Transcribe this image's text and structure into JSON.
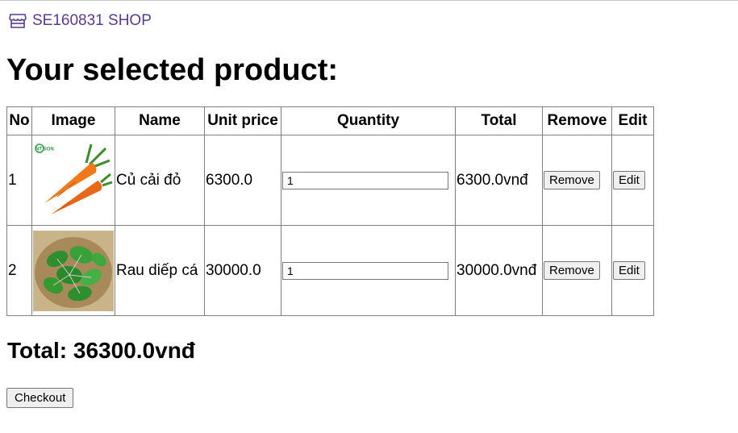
{
  "header": {
    "shop_link": "SE160831 SHOP",
    "shop_icon": "store-icon"
  },
  "page_title": "Your selected product:",
  "table": {
    "columns": [
      "No",
      "Image",
      "Name",
      "Unit price",
      "Quantity",
      "Total",
      "Remove",
      "Edit"
    ],
    "rows": [
      {
        "no": "1",
        "image": "carrot-image",
        "image_badge": "NT SON",
        "name": "Củ cải đỏ",
        "unit_price": "6300.0",
        "quantity": "1",
        "total": "6300.0vnđ",
        "remove_label": "Remove",
        "edit_label": "Edit"
      },
      {
        "no": "2",
        "image": "fish-mint-leaves-image",
        "name": "Rau diếp cá",
        "unit_price": "30000.0",
        "quantity": "1",
        "total": "30000.0vnđ",
        "remove_label": "Remove",
        "edit_label": "Edit"
      }
    ]
  },
  "grand_total": "Total: 36300.0vnđ",
  "checkout_label": "Checkout",
  "colors": {
    "link": "#5b3a8f",
    "border": "#808080",
    "button_bg": "#efefef"
  }
}
